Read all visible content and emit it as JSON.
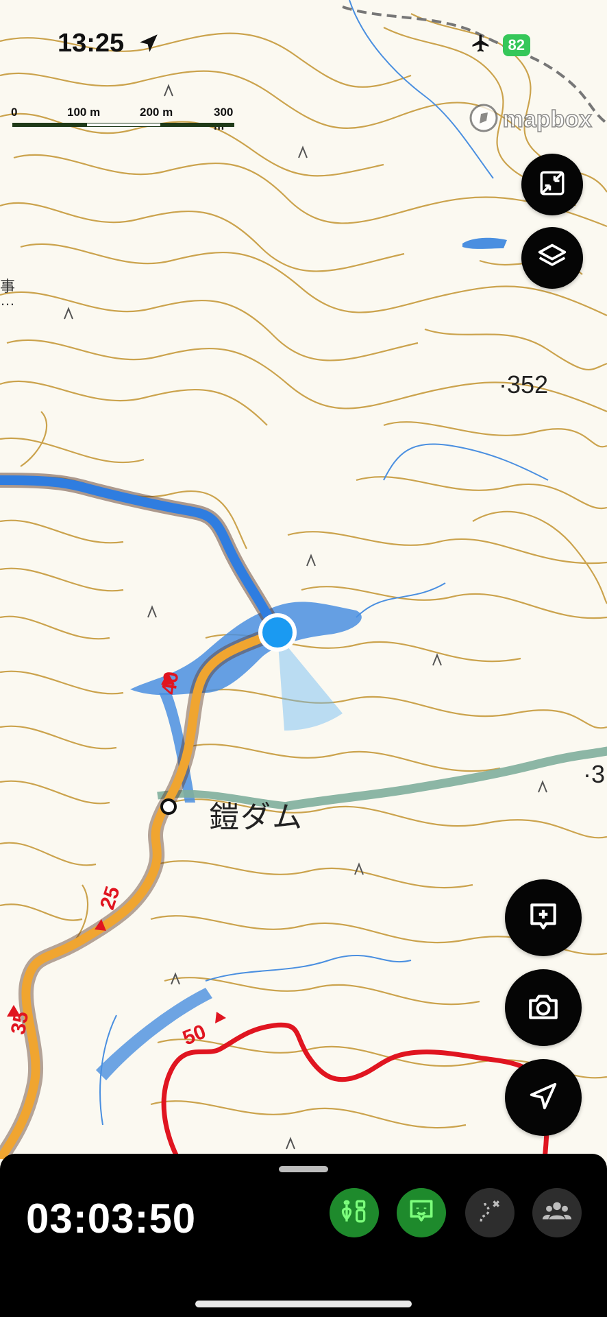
{
  "status_bar": {
    "time": "13:25",
    "battery": "82"
  },
  "scale_bar": {
    "labels": [
      "0",
      "100 m",
      "200 m",
      "300 m"
    ]
  },
  "map": {
    "attribution": "mapbox",
    "dam_label": "鎧ダム",
    "elevations": [
      "352",
      "3"
    ],
    "edge_labels": [
      "事",
      "…"
    ],
    "route_markers": [
      "40",
      "25",
      "35",
      "50"
    ],
    "colors": {
      "background": "#fbf9f1",
      "contour": "#c69a3c",
      "water": "#4a8fe0",
      "blue_route": "#2f7de0",
      "orange_route": "#f0a530",
      "red_route": "#e01520",
      "location": "#1a9af2",
      "green_trail": "#7fae9c"
    }
  },
  "controls": {
    "fullscreen": "fullscreen-toggle-icon",
    "layers": "layers-icon",
    "add_note": "add-note-icon",
    "camera": "camera-icon",
    "locate": "location-arrow-icon"
  },
  "bottom_panel": {
    "elapsed_time": "03:03:50",
    "buttons": [
      "trail-markers-icon",
      "chat-icon",
      "route-icon",
      "group-icon"
    ],
    "accent": "#1e8a2c"
  }
}
